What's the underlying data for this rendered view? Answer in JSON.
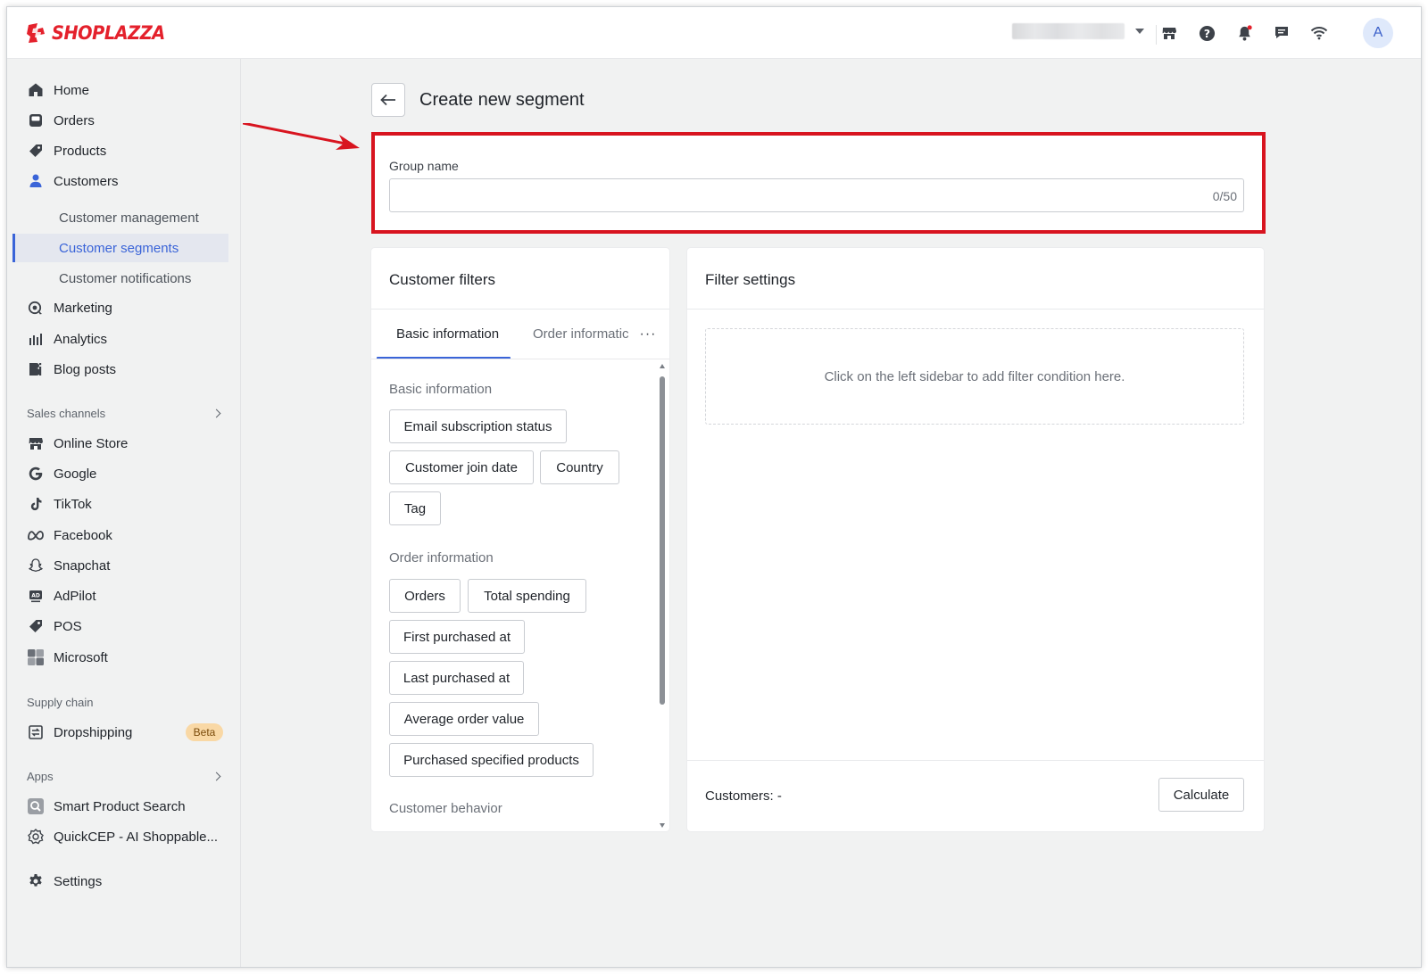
{
  "brand": {
    "name": "SHOPLAZZA",
    "color": "#e4212c"
  },
  "colors": {
    "accent": "#3a64d8",
    "highlight": "#d8141f",
    "beta_bg": "#f9d8a5"
  },
  "topbar": {
    "icons": [
      "store-icon",
      "help-icon",
      "bell-icon",
      "chat-icon",
      "wifi-icon"
    ],
    "avatar_letter": "A"
  },
  "sidebar": {
    "main": [
      {
        "label": "Home",
        "icon": "home-icon"
      },
      {
        "label": "Orders",
        "icon": "orders-icon"
      },
      {
        "label": "Products",
        "icon": "tag-icon"
      },
      {
        "label": "Customers",
        "icon": "person-icon"
      }
    ],
    "customers_sub": [
      {
        "label": "Customer management"
      },
      {
        "label": "Customer segments",
        "active": true
      },
      {
        "label": "Customer notifications"
      }
    ],
    "more": [
      {
        "label": "Marketing",
        "icon": "marketing-icon"
      },
      {
        "label": "Analytics",
        "icon": "analytics-icon"
      },
      {
        "label": "Blog posts",
        "icon": "blog-icon"
      }
    ],
    "sales_channels_label": "Sales channels",
    "sales_channels": [
      {
        "label": "Online Store",
        "icon": "store-icon"
      },
      {
        "label": "Google",
        "icon": "google-icon"
      },
      {
        "label": "TikTok",
        "icon": "tiktok-icon"
      },
      {
        "label": "Facebook",
        "icon": "meta-icon"
      },
      {
        "label": "Snapchat",
        "icon": "snapchat-icon"
      },
      {
        "label": "AdPilot",
        "icon": "adpilot-icon"
      },
      {
        "label": "POS",
        "icon": "pos-icon"
      },
      {
        "label": "Microsoft",
        "icon": "microsoft-icon"
      }
    ],
    "supply_chain_label": "Supply chain",
    "supply_chain": [
      {
        "label": "Dropshipping",
        "icon": "dropshipping-icon",
        "badge": "Beta"
      }
    ],
    "apps_label": "Apps",
    "apps": [
      {
        "label": "Smart Product Search",
        "icon": "search-app-icon"
      },
      {
        "label": "QuickCEP - AI Shoppable...",
        "icon": "quickcep-icon"
      }
    ],
    "settings": {
      "label": "Settings",
      "icon": "gear-icon"
    }
  },
  "page": {
    "title": "Create new segment",
    "group_name": {
      "label": "Group name",
      "value": "",
      "counter": "0/50"
    }
  },
  "filters": {
    "title": "Customer filters",
    "tabs": [
      {
        "label": "Basic information",
        "active": true
      },
      {
        "label": "Order informatic"
      }
    ],
    "more": "···",
    "groups": [
      {
        "heading": "Basic information",
        "chips": [
          "Email subscription status",
          "Customer join date",
          "Country",
          "Tag"
        ]
      },
      {
        "heading": "Order information",
        "chips": [
          "Orders",
          "Total spending",
          "First purchased at",
          "Last purchased at",
          "Average order value",
          "Purchased specified products"
        ]
      },
      {
        "heading": "Customer behavior",
        "chips": []
      }
    ]
  },
  "settings_panel": {
    "title": "Filter settings",
    "placeholder": "Click on the left sidebar to add filter condition here.",
    "customers_label": "Customers: -",
    "calculate": "Calculate"
  }
}
